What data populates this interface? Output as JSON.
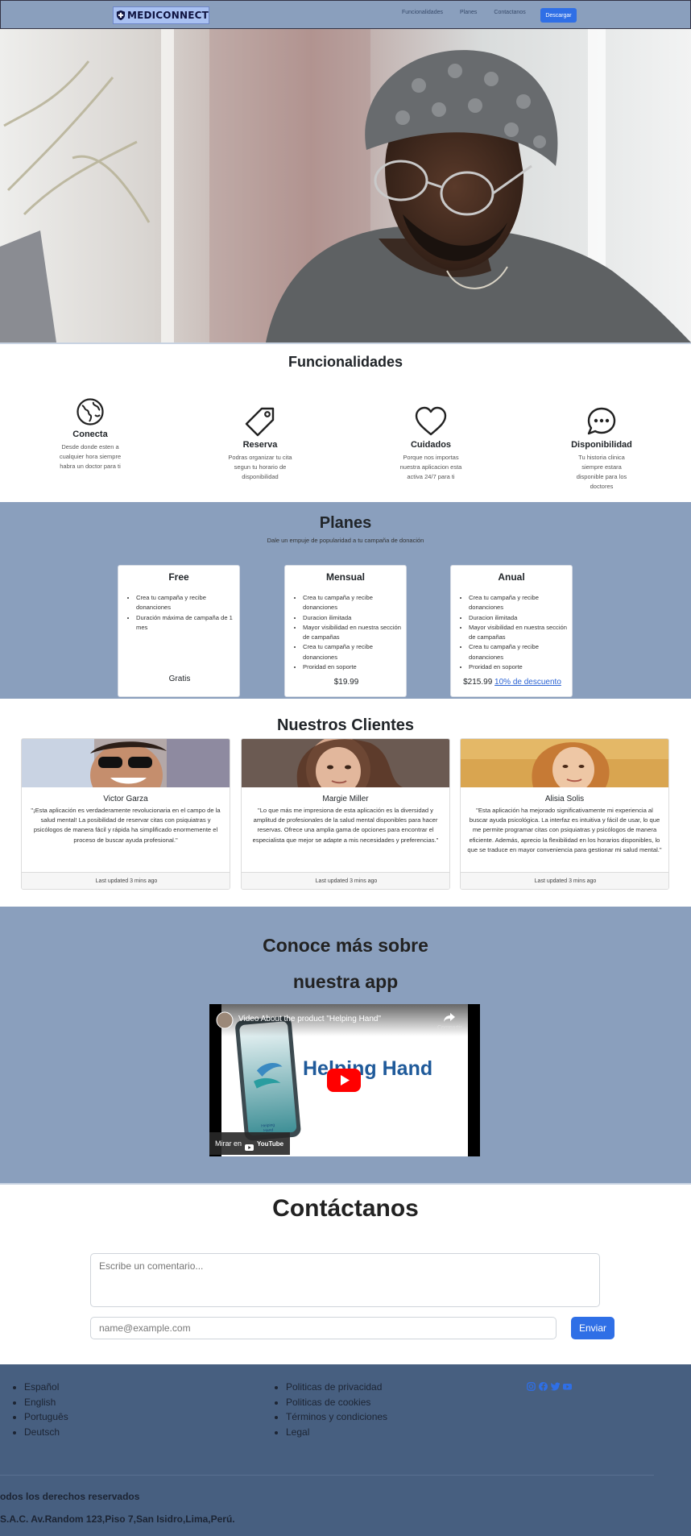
{
  "navbar": {
    "brand": "MEDICONNECT",
    "links": [
      "Funcionalidades",
      "Planes",
      "Contactanos"
    ],
    "cta": "Descargar"
  },
  "features": {
    "title": "Funcionalidades",
    "items": [
      {
        "icon": "globe-icon",
        "title": "Conecta",
        "desc": "Desde donde esten a cualquier hora siempre habra un doctor para ti"
      },
      {
        "icon": "tag-icon",
        "title": "Reserva",
        "desc": "Podras organizar tu cita segun tu horario de disponibilidad"
      },
      {
        "icon": "heart-icon",
        "title": "Cuidados",
        "desc": "Porque nos importas nuestra aplicacion esta activa 24/7 para ti"
      },
      {
        "icon": "chat-dots-icon",
        "title": "Disponibilidad",
        "desc": "Tu historia clinica siempre estara disponible para los doctores"
      }
    ]
  },
  "plans": {
    "title": "Planes",
    "subtitle": "Dale un empuje de popularidad a tu campaña de donación",
    "cards": [
      {
        "name": "Free",
        "features": [
          "Crea tu campaña y recibe donanciones",
          "Duración máxima de campaña de 1 mes"
        ],
        "price": "Gratis",
        "discount": ""
      },
      {
        "name": "Mensual",
        "features": [
          "Crea tu campaña y recibe donanciones",
          "Duracion ilimitada",
          "Mayor visibilidad en nuestra sección de campañas",
          "Crea tu campaña y recibe donanciones",
          "Proridad en soporte"
        ],
        "price": "$19.99",
        "discount": ""
      },
      {
        "name": "Anual",
        "features": [
          "Crea tu campaña y recibe donanciones",
          "Duracion ilimitada",
          "Mayor visibilidad en nuestra sección de campañas",
          "Crea tu campaña y recibe donanciones",
          "Proridad en soporte"
        ],
        "price": "$215.99",
        "discount": "10% de descuento"
      }
    ]
  },
  "clients": {
    "title": "Nuestros Clientes",
    "items": [
      {
        "name": "Victor Garza",
        "quote": "\"¡Esta aplicación es verdaderamente revolucionaria en el campo de la salud mental! La posibilidad de reservar citas con psiquiatras y psicólogos de manera fácil y rápida ha simplificado enormemente el proceso de buscar ayuda profesional.\"",
        "footer": "Last updated 3 mins ago"
      },
      {
        "name": "Margie Miller",
        "quote": "\"Lo que más me impresiona de esta aplicación es la diversidad y amplitud de profesionales de la salud mental disponibles para hacer reservas. Ofrece una amplia gama de opciones para encontrar el especialista que mejor se adapte a mis necesidades y preferencias.\"",
        "footer": "Last updated 3 mins ago"
      },
      {
        "name": "Alisia Solis",
        "quote": "\"Esta aplicación ha mejorado significativamente mi experiencia al buscar ayuda psicológica. La interfaz es intuitiva y fácil de usar, lo que me permite programar citas con psiquiatras y psicólogos de manera eficiente. Además, aprecio la flexibilidad en los horarios disponibles, lo que se traduce en mayor conveniencia para gestionar mi salud mental.\"",
        "footer": "Last updated 3 mins ago"
      }
    ]
  },
  "app": {
    "title_line1": "Conoce más sobre",
    "title_line2": "nuestra app",
    "video": {
      "title": "Video About the product \"Helping Hand\"",
      "share": "Compartir",
      "brand": "Helping Hand",
      "phone_label": "Helping Hand",
      "watch_on": "Mirar en",
      "youtube": "YouTube"
    }
  },
  "contact": {
    "title": "Contáctanos",
    "comment_placeholder": "Escribe un comentario...",
    "email_placeholder": "name@example.com",
    "send": "Enviar"
  },
  "footer": {
    "languages": [
      "Español",
      "English",
      "Português",
      "Deutsch"
    ],
    "legal": [
      "Politicas de privacidad",
      "Politicas de cookies",
      "Términos y condiciones",
      "Legal"
    ],
    "social": [
      "instagram-icon",
      "facebook-icon",
      "twitter-icon",
      "youtube-icon"
    ],
    "rights": "odos los derechos reservados",
    "address": "S.A.C. Av.Random 123,Piso 7,San Isidro,Lima,Perú."
  },
  "colors": {
    "band": "#8a9fbd",
    "footer": "#475f80",
    "primary": "#2f6fe6"
  }
}
